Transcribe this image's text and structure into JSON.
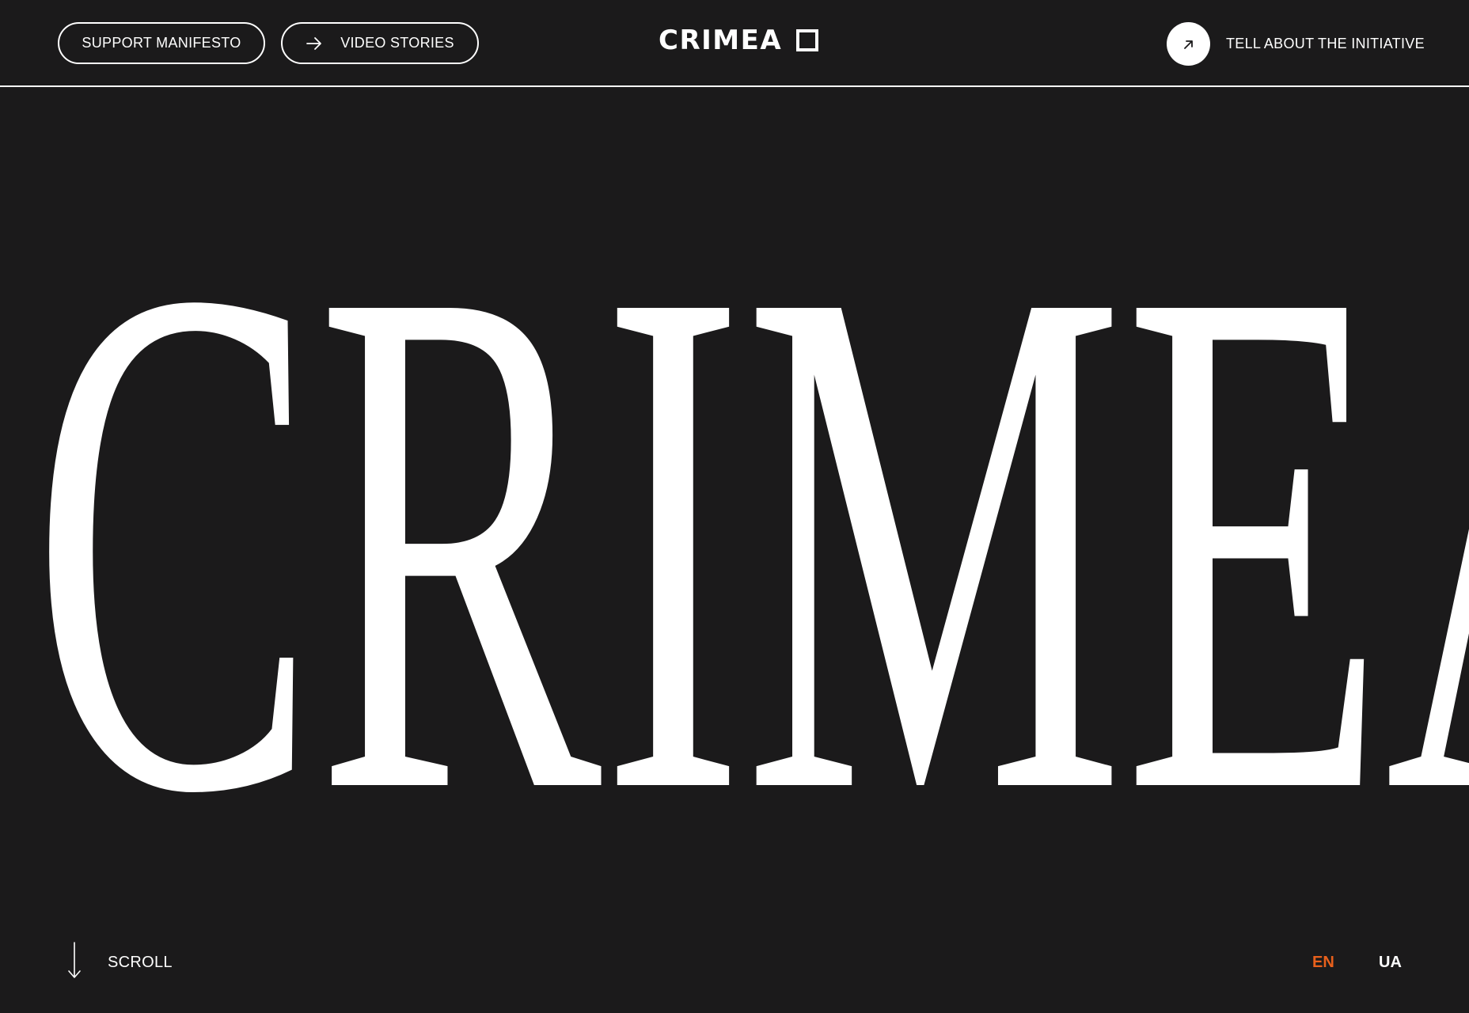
{
  "header": {
    "support_manifesto": "SUPPORT MANIFESTO",
    "video_stories": "VIDEO STORIES",
    "brand": "CRIMEA",
    "tell_about": "TELL ABOUT THE INITIATIVE"
  },
  "hero": {
    "word": "CRIMEA"
  },
  "footer": {
    "scroll": "SCROLL",
    "languages": [
      {
        "code": "EN",
        "active": true
      },
      {
        "code": "UA",
        "active": false
      }
    ]
  },
  "colors": {
    "background": "#1b1a1b",
    "foreground": "#ffffff",
    "accent": "#e8601c"
  },
  "icons": {
    "video_stories": "arrow-right-icon",
    "brand": "square-outline-icon",
    "tell_about": "arrow-up-right-icon",
    "scroll": "arrow-down-icon"
  }
}
